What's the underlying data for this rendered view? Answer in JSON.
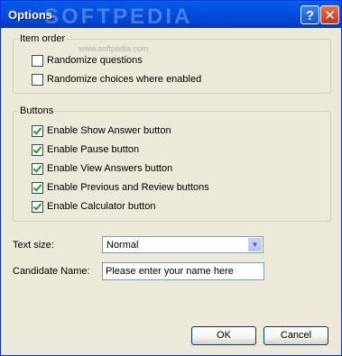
{
  "window": {
    "title": "Options",
    "help_symbol": "?",
    "close_symbol": "✕",
    "watermark": "SOFTPEDIA",
    "watermark_sub": "www.softpedia.com"
  },
  "item_order": {
    "legend": "Item order",
    "options": [
      {
        "label": "Randomize questions",
        "checked": false
      },
      {
        "label": "Randomize choices where enabled",
        "checked": false
      }
    ]
  },
  "buttons_group": {
    "legend": "Buttons",
    "options": [
      {
        "label": "Enable Show Answer button",
        "checked": true
      },
      {
        "label": "Enable Pause button",
        "checked": true
      },
      {
        "label": "Enable View Answers button",
        "checked": true
      },
      {
        "label": "Enable Previous and Review buttons",
        "checked": true
      },
      {
        "label": "Enable Calculator button",
        "checked": true
      }
    ]
  },
  "text_size": {
    "label": "Text size:",
    "value": "Normal"
  },
  "candidate_name": {
    "label": "Candidate Name:",
    "value": "Please enter your name here"
  },
  "footer": {
    "ok_label": "OK",
    "cancel_label": "Cancel"
  }
}
